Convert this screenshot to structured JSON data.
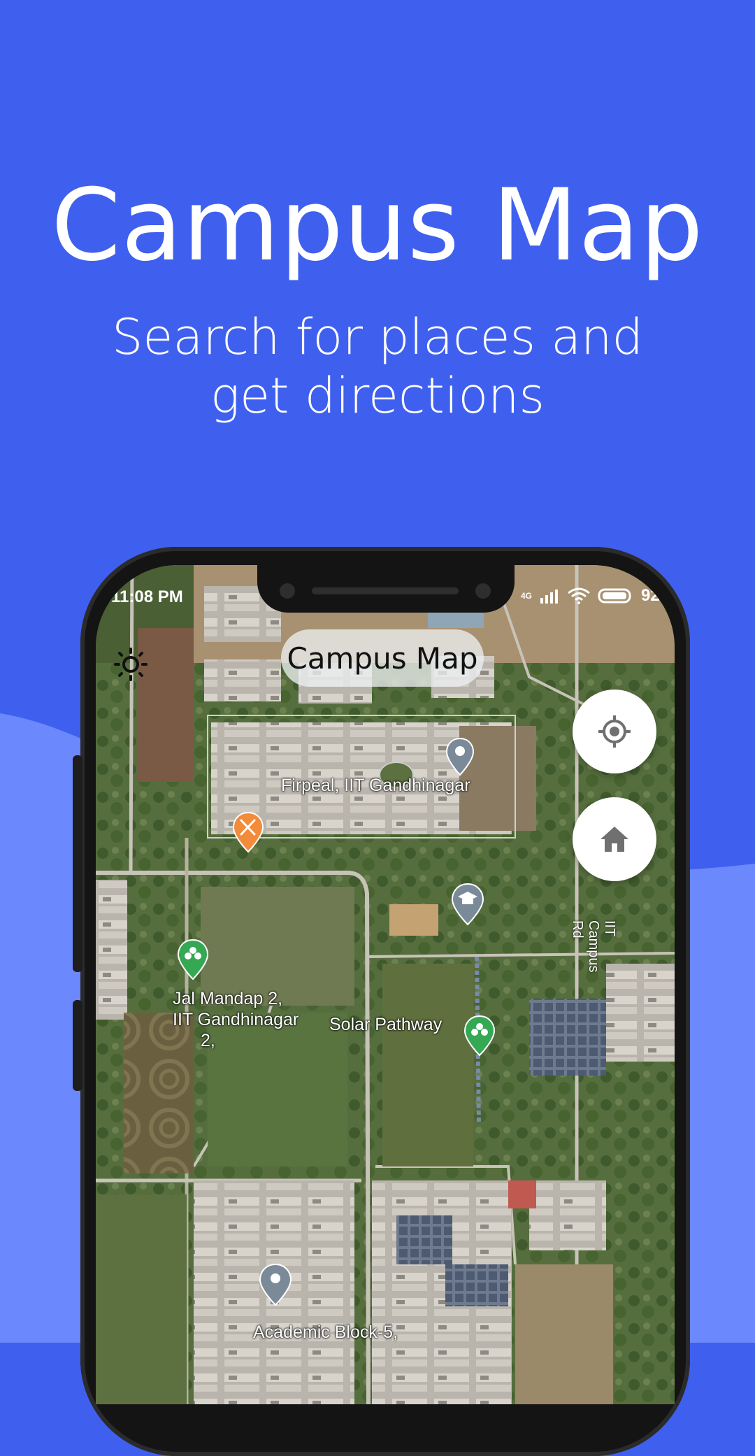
{
  "hero": {
    "title": "Campus Map",
    "subtitle_line1": "Search for places and",
    "subtitle_line2": "get directions"
  },
  "colors": {
    "background": "#3f60ee",
    "wave": "#6b88fc",
    "restaurant_pin": "#f28b3a",
    "park_pin": "#34a853",
    "place_pin": "#7b8a99"
  },
  "status_bar": {
    "time": "11:08 PM",
    "network": "4G",
    "battery": "92%"
  },
  "app": {
    "title": "Campus Map",
    "theme_icon": "sun-icon",
    "locate_icon": "my-location-icon",
    "home_icon": "home-icon"
  },
  "map": {
    "labels": {
      "firpeal": "Firpeal, IIT Gandhinagar",
      "jal_line1": "Jal Mandap 2,",
      "jal_line2": "IIT Gandhinagar",
      "jal_line3": "2,",
      "solar": "Solar Pathway",
      "academic": "Academic Block-5,",
      "road": "IIT Campus Rd"
    }
  }
}
